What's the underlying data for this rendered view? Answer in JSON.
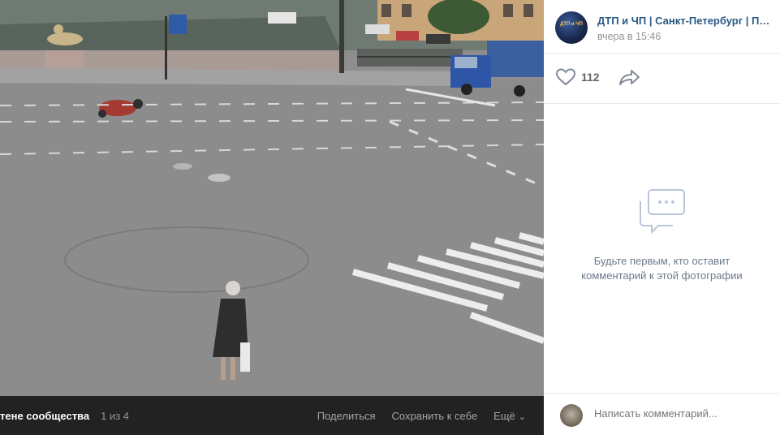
{
  "post": {
    "author": "ДТП и ЧП | Санкт-Петербург | Питер Онлайн",
    "time": "вчера в 15:46",
    "avatar_text": "ДТП и ЧП"
  },
  "actions": {
    "likes": "112",
    "like_icon": "heart-icon",
    "share_icon": "share-arrow-icon"
  },
  "comments": {
    "empty_line1": "Будьте первым, кто оставит",
    "empty_line2": "комментарий к этой фотографии",
    "empty_icon": "comments-icon",
    "input_placeholder": "Написать комментарий..."
  },
  "viewer": {
    "album_title": "тене сообщества",
    "counter": "1 из 4",
    "share_label": "Поделиться",
    "save_label": "Сохранить к себе",
    "more_label": "Ещё"
  },
  "colors": {
    "link": "#2a5885",
    "bar_bg": "#222222",
    "muted": "#939393"
  }
}
